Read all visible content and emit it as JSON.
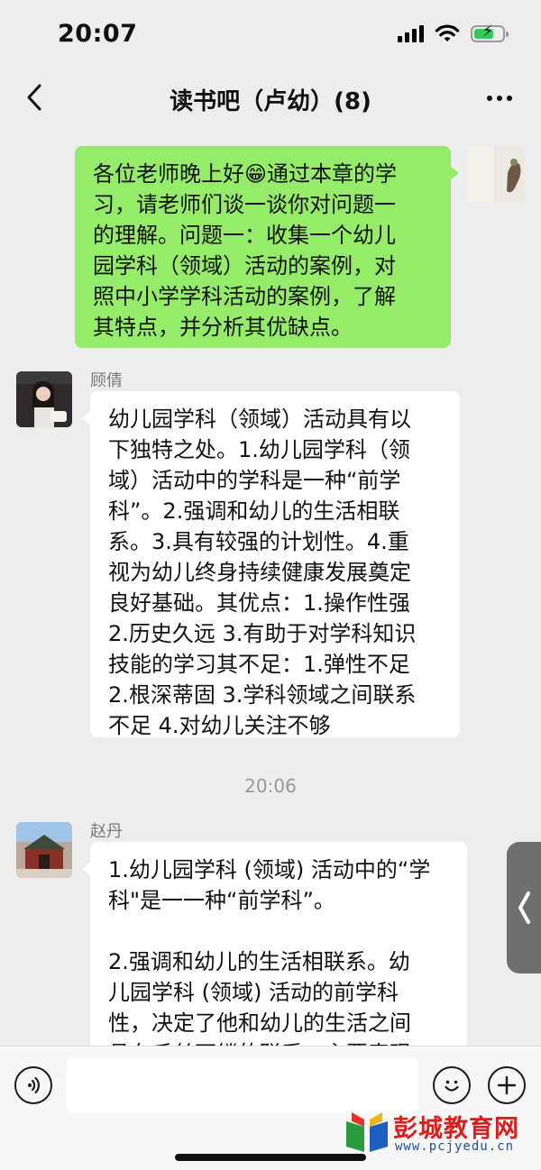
{
  "status_bar": {
    "time": "20:07",
    "icons": [
      "signal-icon",
      "wifi-icon",
      "battery-charging-icon"
    ],
    "battery_level": 0.7
  },
  "nav": {
    "title": "读书吧（卢幼）(8)",
    "back_icon": "chevron-left-icon",
    "more_icon": "more-dots-icon"
  },
  "messages": [
    {
      "sender": "me",
      "text": "各位老师晚上好😁通过本章的学\n习，请老师们谈一谈你对问题一\n的理解。问题一：收集一个幼儿\n园学科（领域）活动的案例，对\n照中小学学科活动的案例，了解\n其特点，并分析其优缺点。"
    },
    {
      "sender": "顾倩",
      "text": "幼儿园学科（领域）活动具有以\n下独特之处。1.幼儿园学科（领\n域）活动中的学科是一种“前学\n科”。2.强调和幼儿的生活相联\n系。3.具有较强的计划性。4.重\n视为幼儿终身持续健康发展奠定\n良好基础。其优点：1.操作性强\n2.历史久远 3.有助于对学科知识\n技能的学习其不足：1.弹性不足\n2.根深蒂固 3.学科领域之间联系\n不足 4.对幼儿关注不够"
    },
    {
      "timestamp": "20:06"
    },
    {
      "sender": "赵丹",
      "text": "1.幼儿园学科 (领域) 活动中的“学\n科\"是一一种“前学科”。\n\n2.强调和幼儿的生活相联系。幼\n儿园学科 (领域) 活动的前学科\n性，决定了他和幼儿的生活之间\n具有千丝万缕的联系。主要表现"
    }
  ],
  "side_tab_icon": "chevron-left-icon",
  "input_bar": {
    "voice_icon": "voice-icon",
    "emoji_icon": "emoji-icon",
    "plus_icon": "plus-icon",
    "placeholder": ""
  },
  "watermark": {
    "name": "彭城教育网",
    "url": "www.pcjyedu.cn"
  },
  "colors": {
    "background": "#ededed",
    "my_bubble": "#95ec69",
    "their_bubble": "#ffffff",
    "watermark_red": "#d6201e",
    "watermark_blue": "#1f4fa8"
  }
}
